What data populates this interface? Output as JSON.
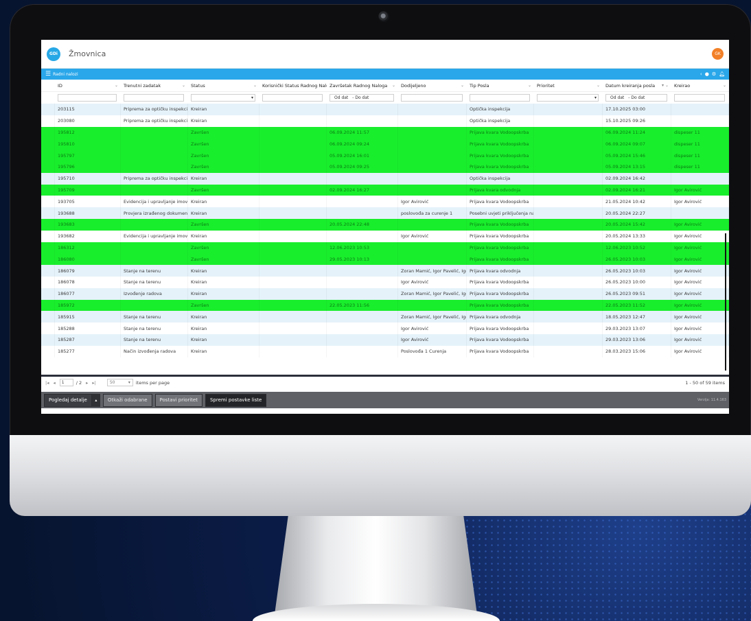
{
  "app": {
    "logo_text": "GDi",
    "title": "Žmovnica",
    "avatar_initials": "GK"
  },
  "bar": {
    "menu_label": "Radni nalozi",
    "icons": [
      "refresh-icon",
      "settings-icon",
      "bell-icon"
    ]
  },
  "columns": [
    {
      "key": "id",
      "label": "ID"
    },
    {
      "key": "task",
      "label": "Trenutni zadatak"
    },
    {
      "key": "status",
      "label": "Status"
    },
    {
      "key": "user_status",
      "label": "Korisnički Status Radnog Nalo..."
    },
    {
      "key": "done",
      "label": "Završetak Radnog Naloga"
    },
    {
      "key": "assigned",
      "label": "Dodijeljeno"
    },
    {
      "key": "type",
      "label": "Tip Posla"
    },
    {
      "key": "priority",
      "label": "Prioritet"
    },
    {
      "key": "created",
      "label": "Datum kreiranja posla"
    },
    {
      "key": "creator",
      "label": "Kreirao"
    }
  ],
  "filters": {
    "done_from": "Od dat",
    "done_to": "- Do dat",
    "created_from": "Od dat",
    "created_to": "- Do dat"
  },
  "rows": [
    {
      "style": "b",
      "id": "203115",
      "task": "Priprema za optičku inspekciju",
      "status": "Kreiran",
      "done": "",
      "assigned": "",
      "type": "Optička inspekcija",
      "created": "17.10.2025 03:00",
      "creator": ""
    },
    {
      "style": "w",
      "id": "203080",
      "task": "Priprema za optičku inspekciju",
      "status": "Kreiran",
      "done": "",
      "assigned": "",
      "type": "Optička inspekcija",
      "created": "15.10.2025 09:26",
      "creator": ""
    },
    {
      "style": "g",
      "id": "195812",
      "task": "",
      "status": "Završen",
      "done": "06.09.2024 11:57",
      "assigned": "",
      "type": "Prijava kvara Vodoopskrba",
      "created": "06.09.2024 11:24",
      "creator": "dispeser 11"
    },
    {
      "style": "g",
      "id": "195810",
      "task": "",
      "status": "Završen",
      "done": "06.09.2024 09:24",
      "assigned": "",
      "type": "Prijava kvara Vodoopskrba",
      "created": "06.09.2024 09:07",
      "creator": "dispeser 11"
    },
    {
      "style": "g",
      "id": "195797",
      "task": "",
      "status": "Završen",
      "done": "05.09.2024 16:01",
      "assigned": "",
      "type": "Prijava kvara Vodoopskrba",
      "created": "05.09.2024 15:46",
      "creator": "dispeser 11"
    },
    {
      "style": "g",
      "id": "195796",
      "task": "",
      "status": "Završen",
      "done": "05.09.2024 09:25",
      "assigned": "",
      "type": "Prijava kvara Vodoopskrba",
      "created": "05.09.2024 13:15",
      "creator": "dispeser 11"
    },
    {
      "style": "b",
      "id": "195710",
      "task": "Priprema za optičku inspekciju",
      "status": "Kreiran",
      "done": "",
      "assigned": "",
      "type": "Optička inspekcija",
      "created": "02.09.2024 16:42",
      "creator": ""
    },
    {
      "style": "g",
      "id": "195709",
      "task": "",
      "status": "Završen",
      "done": "02.09.2024 16:27",
      "assigned": "",
      "type": "Prijava kvara odvodnja",
      "created": "02.09.2024 16:21",
      "creator": "Igor Avirović"
    },
    {
      "style": "w",
      "id": "193705",
      "task": "Evidencija i upravljanje imovin...",
      "status": "Kreiran",
      "done": "",
      "assigned": "Igor Avirović",
      "type": "Prijava kvara Vodoopskrba",
      "created": "21.05.2024 10:42",
      "creator": "Igor Avirović"
    },
    {
      "style": "b",
      "id": "193688",
      "task": "Provjera izrađenog dokumenta",
      "status": "Kreiran",
      "done": "",
      "assigned": "poslovođa za curenje 1",
      "type": "Posebni uvjeti priključenja na ...",
      "created": "20.05.2024 22:27",
      "creator": ""
    },
    {
      "style": "g",
      "id": "193683",
      "task": "",
      "status": "Završen",
      "done": "20.05.2024 22:48",
      "assigned": "",
      "type": "Prijava kvara Vodoopskrba",
      "created": "20.05.2024 15:42",
      "creator": "Igor Avirović"
    },
    {
      "style": "w",
      "id": "193682",
      "task": "Evidencija i upravljanje imovin...",
      "status": "Kreiran",
      "done": "",
      "assigned": "Igor Avirović",
      "type": "Prijava kvara Vodoopskrba",
      "created": "20.05.2024 13:33",
      "creator": "Igor Avirović"
    },
    {
      "style": "g",
      "id": "186312",
      "task": "",
      "status": "Završen",
      "done": "12.06.2023 10:53",
      "assigned": "",
      "type": "Prijava kvara Vodoopskrba",
      "created": "12.06.2023 10:52",
      "creator": "Igor Avirović"
    },
    {
      "style": "g",
      "id": "186080",
      "task": "",
      "status": "Završen",
      "done": "29.05.2023 10:13",
      "assigned": "",
      "type": "Prijava kvara Vodoopskrba",
      "created": "26.05.2023 10:03",
      "creator": "Igor Avirović"
    },
    {
      "style": "b",
      "id": "186079",
      "task": "Stanje na terenu",
      "status": "Kreiran",
      "done": "",
      "assigned": "Zoran Mamić, Igor Pavelić, Igo...",
      "type": "Prijava kvara odvodnja",
      "created": "26.05.2023 10:03",
      "creator": "Igor Avirović"
    },
    {
      "style": "w",
      "id": "186078",
      "task": "Stanje na terenu",
      "status": "Kreiran",
      "done": "",
      "assigned": "Igor Avirović",
      "type": "Prijava kvara Vodoopskrba",
      "created": "26.05.2023 10:00",
      "creator": "Igor Avirović"
    },
    {
      "style": "b",
      "id": "186077",
      "task": "Izvođenje radova",
      "status": "Kreiran",
      "done": "",
      "assigned": "Zoran Mamić, Igor Pavelić, Igo...",
      "type": "Prijava kvara Vodoopskrba",
      "created": "26.05.2023 09:51",
      "creator": "Igor Avirović"
    },
    {
      "style": "g",
      "id": "185972",
      "task": "",
      "status": "Završen",
      "done": "22.05.2023 11:56",
      "assigned": "",
      "type": "Prijava kvara Vodoopskrba",
      "created": "22.05.2023 11:52",
      "creator": "Igor Avirović"
    },
    {
      "style": "b",
      "id": "185915",
      "task": "Stanje na terenu",
      "status": "Kreiran",
      "done": "",
      "assigned": "Zoran Mamić, Igor Pavelić, Igo...",
      "type": "Prijava kvara odvodnja",
      "created": "18.05.2023 12:47",
      "creator": "Igor Avirović"
    },
    {
      "style": "w",
      "id": "185288",
      "task": "Stanje na terenu",
      "status": "Kreiran",
      "done": "",
      "assigned": "Igor Avirović",
      "type": "Prijava kvara Vodoopskrba",
      "created": "29.03.2023 13:07",
      "creator": "Igor Avirović"
    },
    {
      "style": "b",
      "id": "185287",
      "task": "Stanje na terenu",
      "status": "Kreiran",
      "done": "",
      "assigned": "Igor Avirović",
      "type": "Prijava kvara Vodoopskrba",
      "created": "29.03.2023 13:06",
      "creator": "Igor Avirović"
    },
    {
      "style": "w",
      "id": "185277",
      "task": "Način izvođenja radova",
      "status": "Kreiran",
      "done": "",
      "assigned": "Poslovođa 1 Curenja",
      "type": "Prijava kvara Vodoopskrba",
      "created": "28.03.2023 15:06",
      "creator": "Igor Avirović"
    }
  ],
  "pager": {
    "page": "1",
    "of_pages": "/ 2",
    "page_size": "50",
    "items_per_page": "items per page",
    "range": "1 - 50 of 59 items"
  },
  "toolbar": {
    "details": "Pogledaj detalje",
    "unmark": "Otkaži odabrane",
    "priority": "Postavi prioritet",
    "save": "Spremi postavke liste"
  },
  "version": "Verzija: 11.4.163"
}
